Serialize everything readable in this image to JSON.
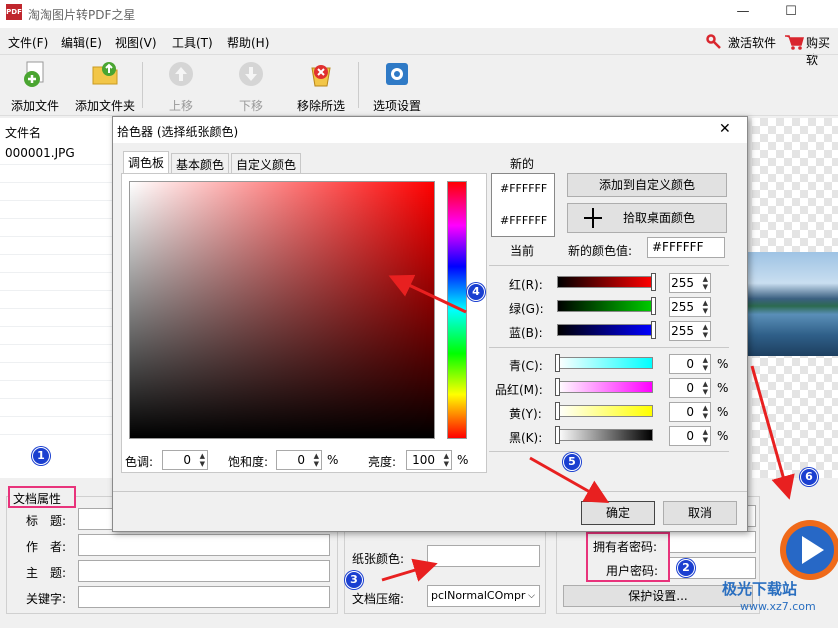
{
  "window": {
    "title": "淘淘图片转PDF之星",
    "app_icon_text": "PDF",
    "minimize": "—",
    "maximize": "☐",
    "close": "✕"
  },
  "menu": {
    "items": [
      "文件(F)",
      "编辑(E)",
      "视图(V)",
      "工具(T)",
      "帮助(H)"
    ],
    "activate": "激活软件",
    "buy": "购买软"
  },
  "toolbar": {
    "add_file": "添加文件",
    "add_folder": "添加文件夹",
    "move_up": "上移",
    "move_down": "下移",
    "remove_selected": "移除所选",
    "options": "选项设置"
  },
  "file_list": {
    "header": "文件名",
    "rows": [
      "000001.JPG"
    ]
  },
  "doc_props": {
    "title": "文档属性",
    "labels": [
      "标　题:",
      "作　者:",
      "主　题:",
      "关键字:"
    ]
  },
  "paper": {
    "paper_color_label": "纸张颜色:",
    "compression_label": "文档压缩:",
    "compression_value": "pclNormalCOmpr"
  },
  "security": {
    "owner_password": "拥有者密码:",
    "user_password": "用户密码:",
    "protect_button": "保护设置..."
  },
  "dialog": {
    "title": "拾色器 (选择纸张颜色)",
    "close": "✕",
    "tabs": [
      "调色板",
      "基本颜色",
      "自定义颜色"
    ],
    "new_label": "新的",
    "current_label": "当前",
    "new_hex": "#FFFFFF",
    "current_hex": "#FFFFFF",
    "add_custom_button": "添加到自定义颜色",
    "pick_desktop_button": "拾取桌面颜色",
    "new_value_label": "新的颜色值:",
    "new_value": "#FFFFFF",
    "rgb": [
      {
        "label": "红(R):",
        "value": "255",
        "color": "#ff0000"
      },
      {
        "label": "绿(G):",
        "value": "255",
        "color": "#00cc00"
      },
      {
        "label": "蓝(B):",
        "value": "255",
        "color": "#0000ff"
      }
    ],
    "cmyk": [
      {
        "label": "青(C):",
        "value": "0",
        "color": "#00ffff"
      },
      {
        "label": "品红(M):",
        "value": "0",
        "color": "#ff00ff"
      },
      {
        "label": "黄(Y):",
        "value": "0",
        "color": "#ffff00"
      },
      {
        "label": "黑(K):",
        "value": "0",
        "color": "#000000"
      }
    ],
    "percent": "%",
    "hue_label": "色调:",
    "hue_value": "0",
    "sat_label": "饱和度:",
    "sat_value": "0",
    "bri_label": "亮度:",
    "bri_value": "100",
    "ok": "确定",
    "cancel": "取消"
  },
  "annotations": {
    "badges": [
      "1",
      "2",
      "3",
      "4",
      "5",
      "6"
    ],
    "arrow_color": "#e82020",
    "highlight_color": "#e8337b",
    "badge_color": "#1a3fd0"
  },
  "watermark": {
    "brand": "极光下载站",
    "url": "www.xz7.com"
  }
}
